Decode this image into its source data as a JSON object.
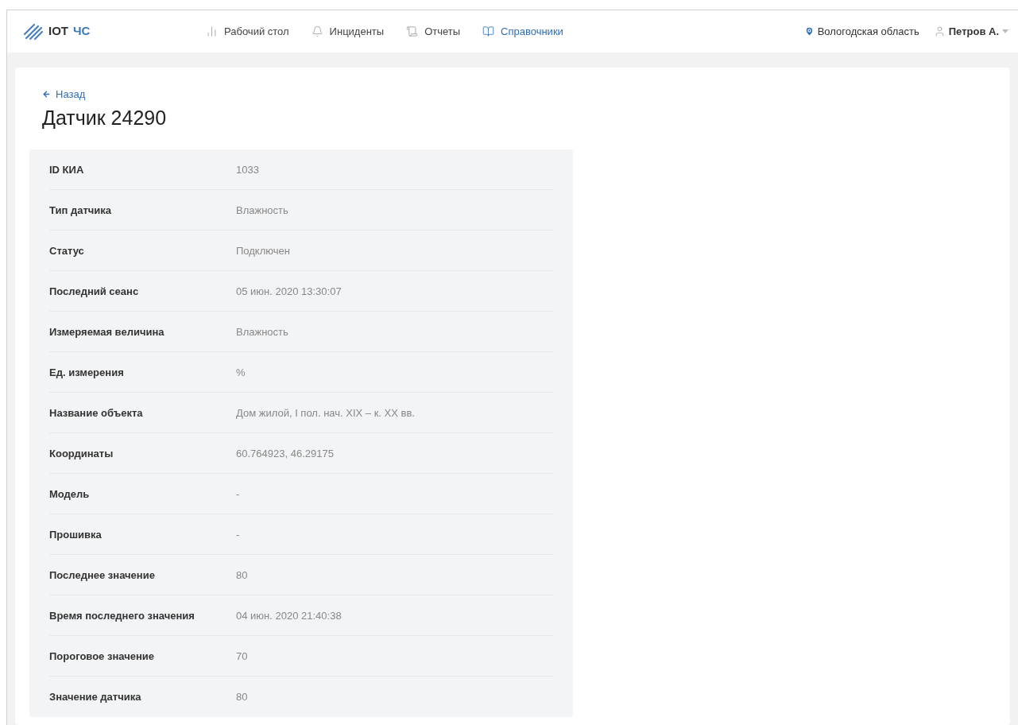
{
  "logo": {
    "name": "IOT",
    "accent": "ЧС"
  },
  "nav": [
    {
      "label": "Рабочий стол",
      "selected": false
    },
    {
      "label": "Инциденты",
      "selected": false
    },
    {
      "label": "Отчеты",
      "selected": false
    },
    {
      "label": "Справочники",
      "selected": true
    }
  ],
  "region": "Вологодская область",
  "user": "Петров А.",
  "back": "Назад",
  "title": "Датчик 24290",
  "fields": [
    {
      "label": "ID КИА",
      "value": "1033"
    },
    {
      "label": "Тип датчика",
      "value": "Влажность"
    },
    {
      "label": "Статус",
      "value": "Подключен"
    },
    {
      "label": "Последний сеанс",
      "value": "05 июн. 2020 13:30:07"
    },
    {
      "label": "Измеряемая величина",
      "value": "Влажность"
    },
    {
      "label": "Ед. измерения",
      "value": "%"
    },
    {
      "label": "Название объекта",
      "value": "Дом жилой, I пол. нач. XIX – к. XX вв."
    },
    {
      "label": "Координаты",
      "value": "60.764923, 46.29175"
    },
    {
      "label": "Модель",
      "value": "-"
    },
    {
      "label": "Прошивка",
      "value": "-"
    },
    {
      "label": "Последнее значение",
      "value": "80"
    },
    {
      "label": "Время последнего значения",
      "value": "04 июн. 2020 21:40:38"
    },
    {
      "label": "Пороговое значение",
      "value": "70"
    },
    {
      "label": "Значение датчика",
      "value": "80"
    }
  ]
}
